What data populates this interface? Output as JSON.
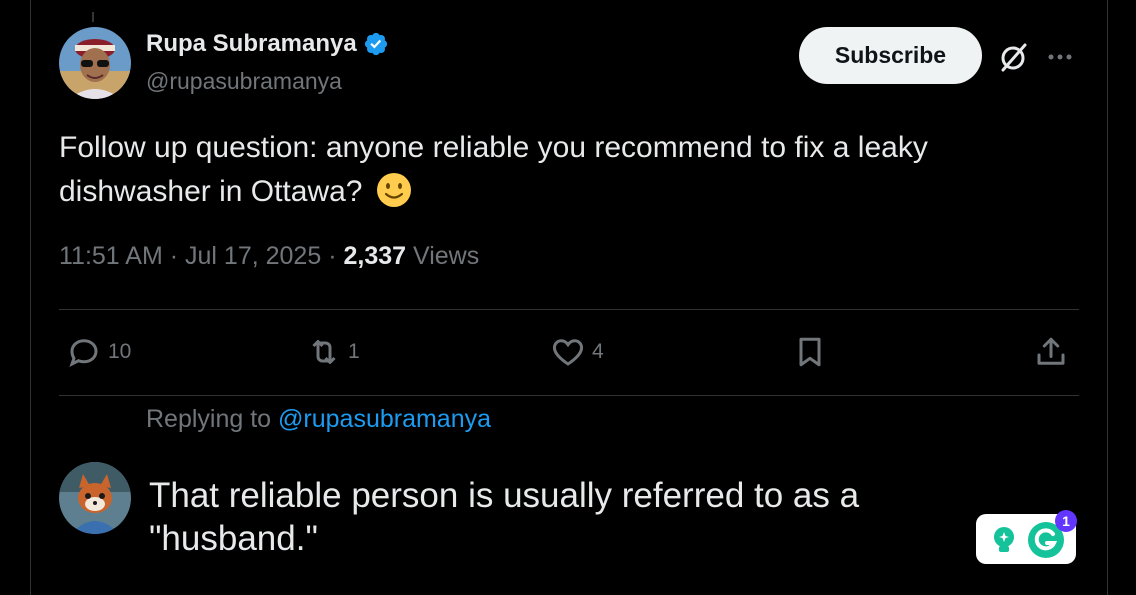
{
  "tweet": {
    "author_name": "Rupa Subramanya",
    "author_handle": "@rupasubramanya",
    "subscribe_label": "Subscribe",
    "text": "Follow up question: anyone reliable you recommend to fix a leaky dishwasher in Ottawa?",
    "emoji": "slightly-smiling-face",
    "time": "11:51 AM",
    "date": "Jul 17, 2025",
    "separator": "·",
    "views_count": "2,337",
    "views_label": "Views"
  },
  "actions": {
    "replies": "10",
    "reposts": "1",
    "likes": "4"
  },
  "reply": {
    "replying_prefix": "Replying to",
    "replying_to": "@rupasubramanya",
    "text": "That reliable person is usually referred to as a \"husband.\""
  },
  "grammarly": {
    "badge_count": "1"
  },
  "colors": {
    "background": "#000000",
    "text_primary": "#e7e9ea",
    "text_secondary": "#71767b",
    "accent_blue": "#1d9bf0",
    "divider": "#2f3336",
    "grammarly_green": "#15c39a",
    "grammarly_badge": "#6236ff"
  }
}
